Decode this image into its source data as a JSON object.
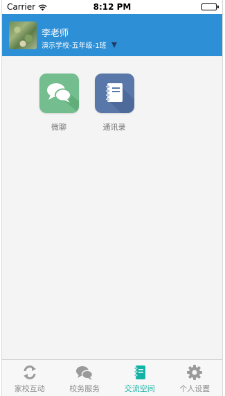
{
  "status_bar": {
    "carrier": "Carrier",
    "time": "8:12 PM",
    "battery_level": 1.0
  },
  "header": {
    "name": "李老师",
    "school": "演示学校-五年级-1班",
    "colors": {
      "background": "#2d8fd6",
      "caret": "#1f3d66"
    }
  },
  "apps": [
    {
      "label": "微聊",
      "icon": "chat-bubbles-icon",
      "color": "#73bd8e"
    },
    {
      "label": "通讯录",
      "icon": "address-book-icon",
      "color": "#5977a8"
    }
  ],
  "tabbar": {
    "tabs": [
      {
        "label": "家校互动",
        "icon": "sync-arrows-icon",
        "active": false
      },
      {
        "label": "校务服务",
        "icon": "chat-bubbles-icon",
        "active": false
      },
      {
        "label": "交流空间",
        "icon": "notebook-icon",
        "active": true
      },
      {
        "label": "个人设置",
        "icon": "gear-icon",
        "active": false
      }
    ],
    "active_color": "#13b3a6",
    "inactive_color": "#8c8c8c"
  }
}
